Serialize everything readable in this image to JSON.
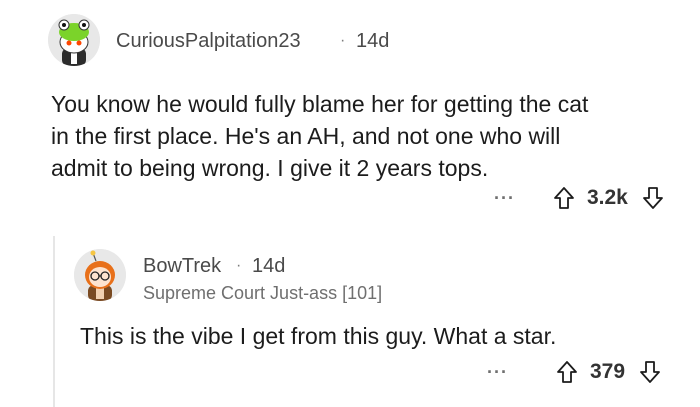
{
  "comment": {
    "username": "CuriousPalpitation23",
    "separator": "·",
    "time": "14d",
    "body_lines": [
      "You know he would fully blame her for getting the cat",
      "in the first place. He's an AH, and not one who will",
      "admit to being wrong.  I give it 2 years tops."
    ],
    "more_label": "···",
    "score": "3.2k",
    "upvote_icon": "upvote-arrow-icon",
    "downvote_icon": "downvote-arrow-icon"
  },
  "reply": {
    "username": "BowTrek",
    "separator": "·",
    "time": "14d",
    "flair": "Supreme Court Just-ass [101]",
    "body_lines": [
      "This is the vibe I get from this guy. What a star."
    ],
    "more_label": "···",
    "score": "379",
    "upvote_icon": "upvote-arrow-icon",
    "downvote_icon": "downvote-arrow-icon"
  },
  "colors": {
    "avatar_bg": "#e8e8e8",
    "text": "#1c1c1c",
    "meta": "#4a4a4a"
  }
}
